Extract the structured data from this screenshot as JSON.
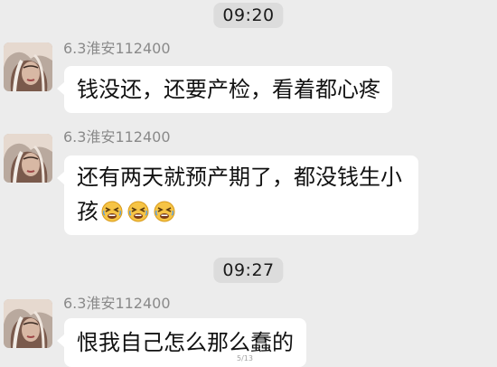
{
  "chat": {
    "timestamps": [
      "09:20",
      "09:27"
    ],
    "messages": [
      {
        "sender": "6.3淮安112400",
        "text": "钱没还，还要产检，看着都心疼"
      },
      {
        "sender": "6.3淮安112400",
        "text": "还有两天就预产期了，都没钱生小孩",
        "emoji_count": 3,
        "emoji_icon": "tired-face-emoji"
      },
      {
        "sender": "6.3淮安112400",
        "text": "恨我自己怎么那么蠢的"
      }
    ]
  },
  "page_indicator": "5/13",
  "colors": {
    "background": "#ececec",
    "bubble": "#ffffff",
    "timestamp_pill": "#dcdcdc",
    "sender_text": "#8a8a8a"
  }
}
